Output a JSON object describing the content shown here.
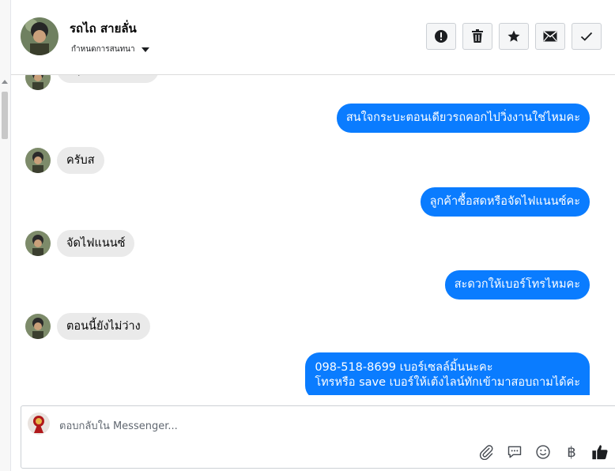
{
  "contact": {
    "name": "รถไถ สายลั่น",
    "subtitle": "กำหนดการสนทนา"
  },
  "actions": [
    {
      "name": "report-icon"
    },
    {
      "name": "trash-icon"
    },
    {
      "name": "star-icon"
    },
    {
      "name": "mail-icon"
    },
    {
      "name": "check-icon"
    }
  ],
  "messages": [
    {
      "dir": "in",
      "text": "มีรุ่นไหนบ้างครับ"
    },
    {
      "dir": "out",
      "text": "สนใจกระบะตอนเดียวรถคอกไปวิ่งงานใช่ไหมคะ"
    },
    {
      "dir": "in",
      "text": "ครับส"
    },
    {
      "dir": "out",
      "text": "ลูกค้าซื้อสดหรือจัดไฟแนนซ์คะ"
    },
    {
      "dir": "in",
      "text": "จัดไฟแนนซ์"
    },
    {
      "dir": "out",
      "text": "สะดวกให้เบอร์โทรไหมคะ"
    },
    {
      "dir": "in",
      "text": "ตอนนี้ยังไม่ว่าง"
    },
    {
      "dir": "out",
      "line1": "098-518-8699 เบอร์เซลล์มิ้นนะคะ",
      "line2": "โทรหรือ save เบอร์ให้เต้งไลน์ทักเข้ามาสอบถามได้ค่ะ"
    }
  ],
  "composer": {
    "placeholder": "ตอบกลับใน Messenger...",
    "baht_symbol": "฿"
  },
  "colors": {
    "outgoing_bubble": "#0a7cff",
    "incoming_bubble": "#eaeaea"
  }
}
